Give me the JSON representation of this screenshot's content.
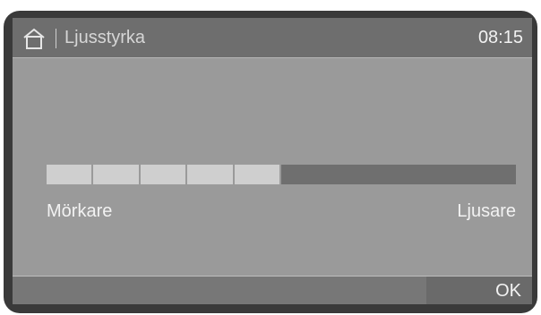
{
  "header": {
    "title": "Ljusstyrka",
    "time": "08:15",
    "home_icon": "home-icon"
  },
  "brightness": {
    "total_segments": 10,
    "active_segments": 5,
    "label_left": "Mörkare",
    "label_right": "Ljusare"
  },
  "footer": {
    "ok_label": "OK"
  },
  "colors": {
    "screen_bg": "#9a9a9a",
    "header_bg": "#6e6e6e",
    "segment_on": "#cfcfcf",
    "segment_off": "#6f6f6f",
    "text": "#f2f2f2"
  }
}
